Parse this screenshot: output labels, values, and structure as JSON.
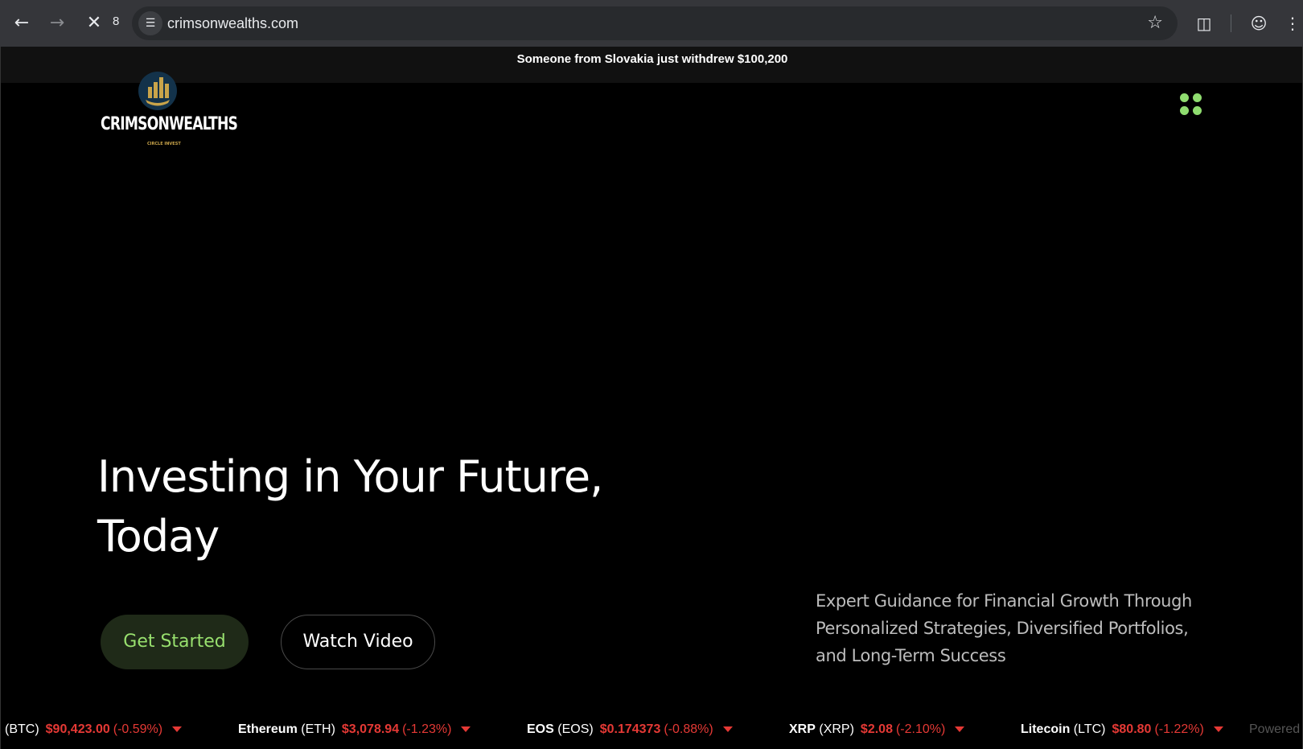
{
  "browser": {
    "url": "crimsonwealths.com",
    "tab_count": "8",
    "icons": [
      "back-icon",
      "forward-icon",
      "stop-icon",
      "site-info-icon",
      "bookmark-star-icon",
      "cast-search-icon",
      "profile-icon",
      "more-menu-icon"
    ]
  },
  "notice": {
    "text": "Someone from Slovakia just withdrew $100,200"
  },
  "logo": {
    "brand": "CRIMSONWEALTHS",
    "tagline": "CIRCLE INVEST"
  },
  "hero": {
    "title_line1": "Investing in Your Future,",
    "title_line2": "Today",
    "primary_button": "Get Started",
    "secondary_button": "Watch Video",
    "subtitle": "Expert Guidance for Financial Growth Through Personalized Strategies, Diversified Portfolios, and Long-Term Success"
  },
  "colors": {
    "accent": "#98e06e",
    "negative": "#e53935",
    "background": "#000000"
  },
  "ticker": {
    "items": [
      {
        "name": "",
        "symbol": "(BTC)",
        "price": "$90,423.00",
        "change": "(-0.59%)"
      },
      {
        "name": "Ethereum",
        "symbol": "(ETH)",
        "price": "$3,078.94",
        "change": "(-1.23%)"
      },
      {
        "name": "EOS",
        "symbol": "(EOS)",
        "price": "$0.174373",
        "change": "(-0.88%)"
      },
      {
        "name": "XRP",
        "symbol": "(XRP)",
        "price": "$2.08",
        "change": "(-2.10%)"
      },
      {
        "name": "Litecoin",
        "symbol": "(LTC)",
        "price": "$80.80",
        "change": "(-1.22%)"
      }
    ],
    "powered": "Powered"
  }
}
